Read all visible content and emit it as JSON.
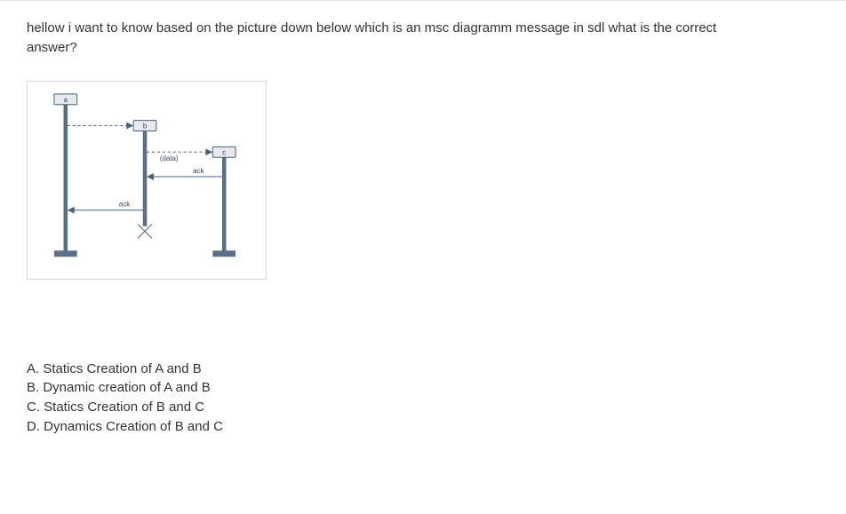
{
  "question": {
    "line1": "hellow i want to know based on the picture down below which is an msc diagramm message in sdl what is the correct",
    "line2": "answer?"
  },
  "diagram": {
    "lifelines": {
      "a": "a",
      "b": "b",
      "c": "c"
    },
    "messages": {
      "data": "(data)",
      "ack_bc": "ack",
      "ack_ab": "ack"
    }
  },
  "options": {
    "a": "A. Statics Creation of A and B",
    "b": "B. Dynamic creation of A and B",
    "c": "C. Statics Creation of B and C",
    "d": "D. Dynamics Creation of B and C"
  }
}
